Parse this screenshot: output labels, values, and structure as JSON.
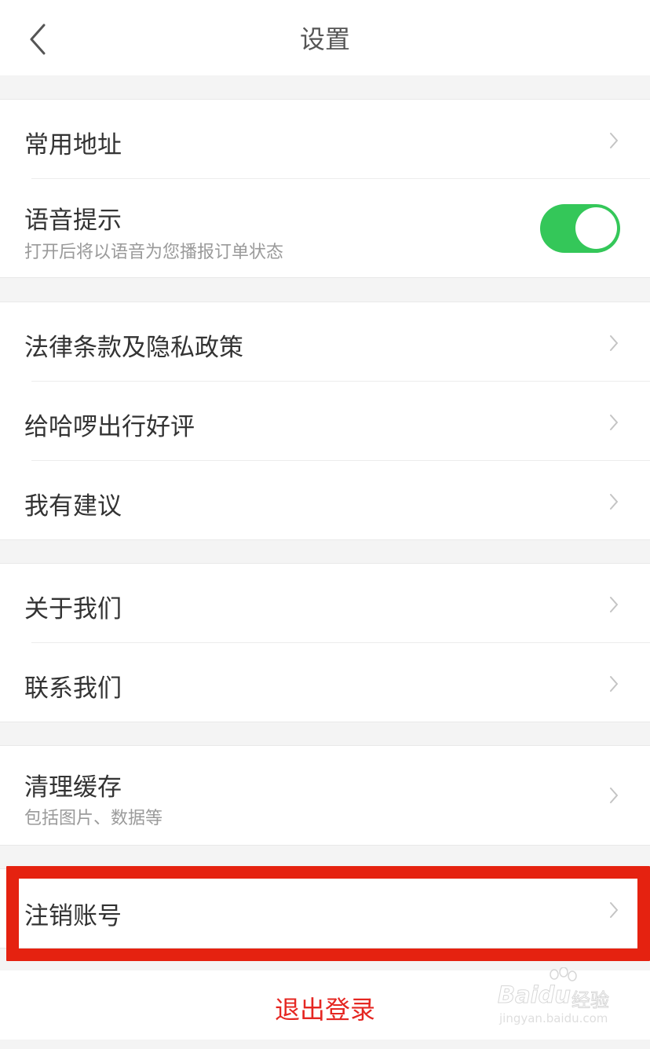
{
  "nav": {
    "back_icon": "chevron-left-icon",
    "title": "设置"
  },
  "groups": {
    "address": {
      "title": "常用地址"
    },
    "voice": {
      "title": "语音提示",
      "subtitle": "打开后将以语音为您播报订单状态",
      "toggle_on": true
    },
    "legal": {
      "title": "法律条款及隐私政策"
    },
    "rate": {
      "title": "给哈啰出行好评"
    },
    "feedback": {
      "title": "我有建议"
    },
    "about": {
      "title": "关于我们"
    },
    "contact": {
      "title": "联系我们"
    },
    "cache": {
      "title": "清理缓存",
      "subtitle": "包括图片、数据等"
    },
    "deactivate": {
      "title": "注销账号"
    }
  },
  "logout": {
    "label": "退出登录"
  },
  "watermark": {
    "brand": "Baidu",
    "cn": "经验",
    "url": "jingyan.baidu.com"
  },
  "colors": {
    "toggle_on": "#34c759",
    "logout_text": "#e52722",
    "highlight_border": "#e52210",
    "background": "#f4f4f4"
  }
}
